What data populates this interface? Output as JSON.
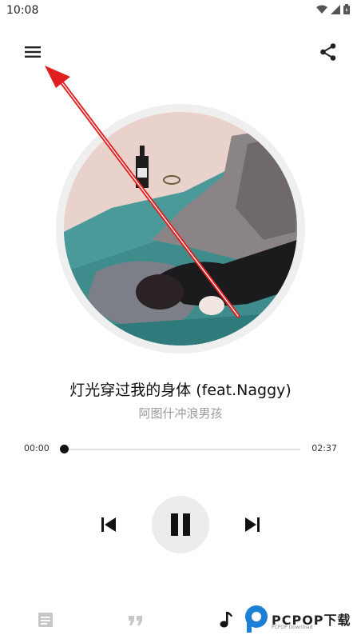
{
  "status_bar": {
    "time": "10:08"
  },
  "song": {
    "title": "灯光穿过我的身体 (feat.Naggy)",
    "artist": "阿图什冲浪男孩"
  },
  "progress": {
    "current": "00:00",
    "duration": "02:37",
    "fraction": 0.0
  },
  "controls": {
    "state": "playing"
  },
  "bottom_nav": {
    "active": "player"
  },
  "watermark": {
    "brand": "PCPOP下载",
    "sub": "PCPOP Download"
  },
  "colors": {
    "accent": "#111111",
    "muted_text": "#9a9a9a",
    "annotation_arrow": "#e02020"
  }
}
